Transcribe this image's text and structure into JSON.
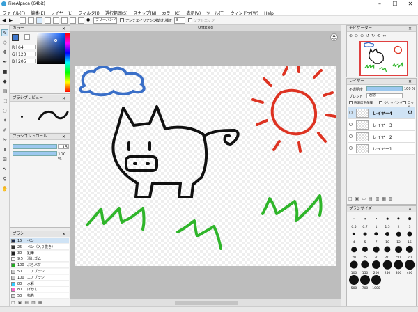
{
  "window": {
    "title": "FireAlpaca (64bit)",
    "min": "–",
    "max": "☐",
    "close": "✕"
  },
  "menu": [
    "ファイル(F)",
    "編集(E)",
    "レイヤー(L)",
    "フィルタ(I)",
    "選択範囲(S)",
    "スナップ(N)",
    "カラー(C)",
    "表示(V)",
    "ツール(T)",
    "ウィンドウ(W)",
    "Help"
  ],
  "toolbar": {
    "mode": "フリーハンド",
    "antialias_label": "アンチエイリアシング",
    "stabilizer_label": "手ぶれ補正",
    "stabilizer_value": "8",
    "soft_edge_label": "ソフトエッジ"
  },
  "color_panel": {
    "title": "カラー",
    "r_label": "R",
    "r": "64",
    "g_label": "G",
    "g": "120",
    "b_label": "B",
    "b": "205",
    "current": "#4078cd"
  },
  "brush_preview": {
    "title": "ブラシプレビュー"
  },
  "brush_control": {
    "title": "ブラシコントロール",
    "size": "15",
    "opacity": "100 %"
  },
  "brush_panel": {
    "title": "ブラシ",
    "items": [
      {
        "size": "15",
        "name": "ペン",
        "color": "#1a2a4a",
        "selected": true
      },
      {
        "size": "25",
        "name": "ペン（入り抜き）",
        "color": "#333333"
      },
      {
        "size": "30",
        "name": "鉛筆",
        "color": "#222222"
      },
      {
        "size": "9.5",
        "name": "消しゴム",
        "color": "#ffffff"
      },
      {
        "size": "100",
        "name": "ぶらバケ",
        "color": "#22aa22"
      },
      {
        "size": "50",
        "name": "エアブラシ",
        "color": "#cccccc"
      },
      {
        "size": "100",
        "name": "エアブラシ",
        "color": "#cccccc"
      },
      {
        "size": "80",
        "name": "水彩",
        "color": "#33ccff"
      },
      {
        "size": "80",
        "name": "ぼかし",
        "color": "#ff66cc"
      },
      {
        "size": "50",
        "name": "指先",
        "color": "#dddddd"
      }
    ]
  },
  "document": {
    "tab": "Untitled"
  },
  "navigator": {
    "title": "ナビゲーター"
  },
  "layer_panel": {
    "title": "レイヤー",
    "opacity_label": "不透明度",
    "opacity": "100 %",
    "blend_label": "ブレンド",
    "blend": "通常",
    "protect_label": "透明度を保護",
    "clipping_label": "クリッピング",
    "lock_label": "ロック",
    "layers": [
      "レイヤー4",
      "レイヤー3",
      "レイヤー2",
      "レイヤー1"
    ]
  },
  "brush_size_panel": {
    "title": "ブラシサイズ",
    "sizes": [
      "0.5",
      "0.7",
      "1",
      "1.5",
      "2",
      "3",
      "4",
      "5",
      "7",
      "10",
      "12",
      "15",
      "20",
      "25",
      "30",
      "40",
      "50",
      "70",
      "100",
      "150",
      "200",
      "250",
      "300",
      "400",
      "500",
      "700",
      "1000"
    ]
  },
  "colors": {
    "cloud": "#3a6fc8",
    "pig": "#111111",
    "sun": "#dd3322",
    "grass": "#2fb52a"
  }
}
